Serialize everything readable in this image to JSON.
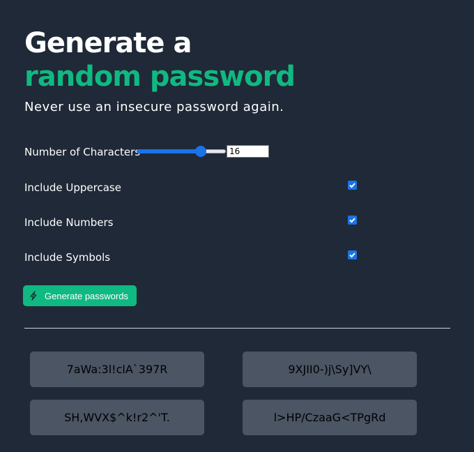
{
  "header": {
    "title_line1": "Generate a",
    "title_line2": "random password",
    "title_accent": "#10b981",
    "subtitle": "Never use an insecure password again."
  },
  "options": {
    "length_label": "Number of Characters",
    "length_value": "16",
    "slider_fraction": 0.75,
    "uppercase_label": "Include Uppercase",
    "uppercase_checked": true,
    "numbers_label": "Include Numbers",
    "numbers_checked": true,
    "symbols_label": "Include Symbols",
    "symbols_checked": true
  },
  "actions": {
    "generate_label": "Generate passwords",
    "generate_icon": "lightning-icon",
    "button_color": "#10b981"
  },
  "passwords": [
    "7aWa:3l!clA`397R",
    "9XJII0-)j\\Sy]VY\\",
    "SH,WVX$^k!r2^'T.",
    "l>HP/CzaaG<TPgRd"
  ]
}
